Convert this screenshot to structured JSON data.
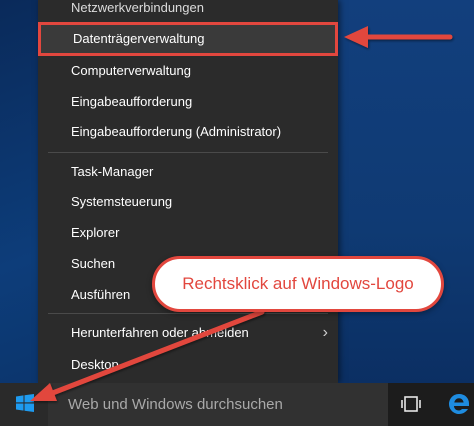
{
  "menu": {
    "items": [
      {
        "label": "Netzwerkverbindungen"
      },
      {
        "label": "Datenträgerverwaltung"
      },
      {
        "label": "Computerverwaltung"
      },
      {
        "label": "Eingabeaufforderung"
      },
      {
        "label": "Eingabeaufforderung (Administrator)"
      },
      {
        "label": "Task-Manager"
      },
      {
        "label": "Systemsteuerung"
      },
      {
        "label": "Explorer"
      },
      {
        "label": "Suchen"
      },
      {
        "label": "Ausführen"
      },
      {
        "label": "Herunterfahren oder abmelden"
      },
      {
        "label": "Desktop"
      }
    ],
    "submenu_glyph": "›"
  },
  "taskbar": {
    "search_placeholder": "Web und Windows durchsuchen",
    "icons": [
      "windows-logo-icon",
      "task-view-icon",
      "edge-browser-icon"
    ]
  },
  "annotation": {
    "callout_text": "Rechtsklick auf Windows-Logo",
    "color": "#e2473e"
  }
}
